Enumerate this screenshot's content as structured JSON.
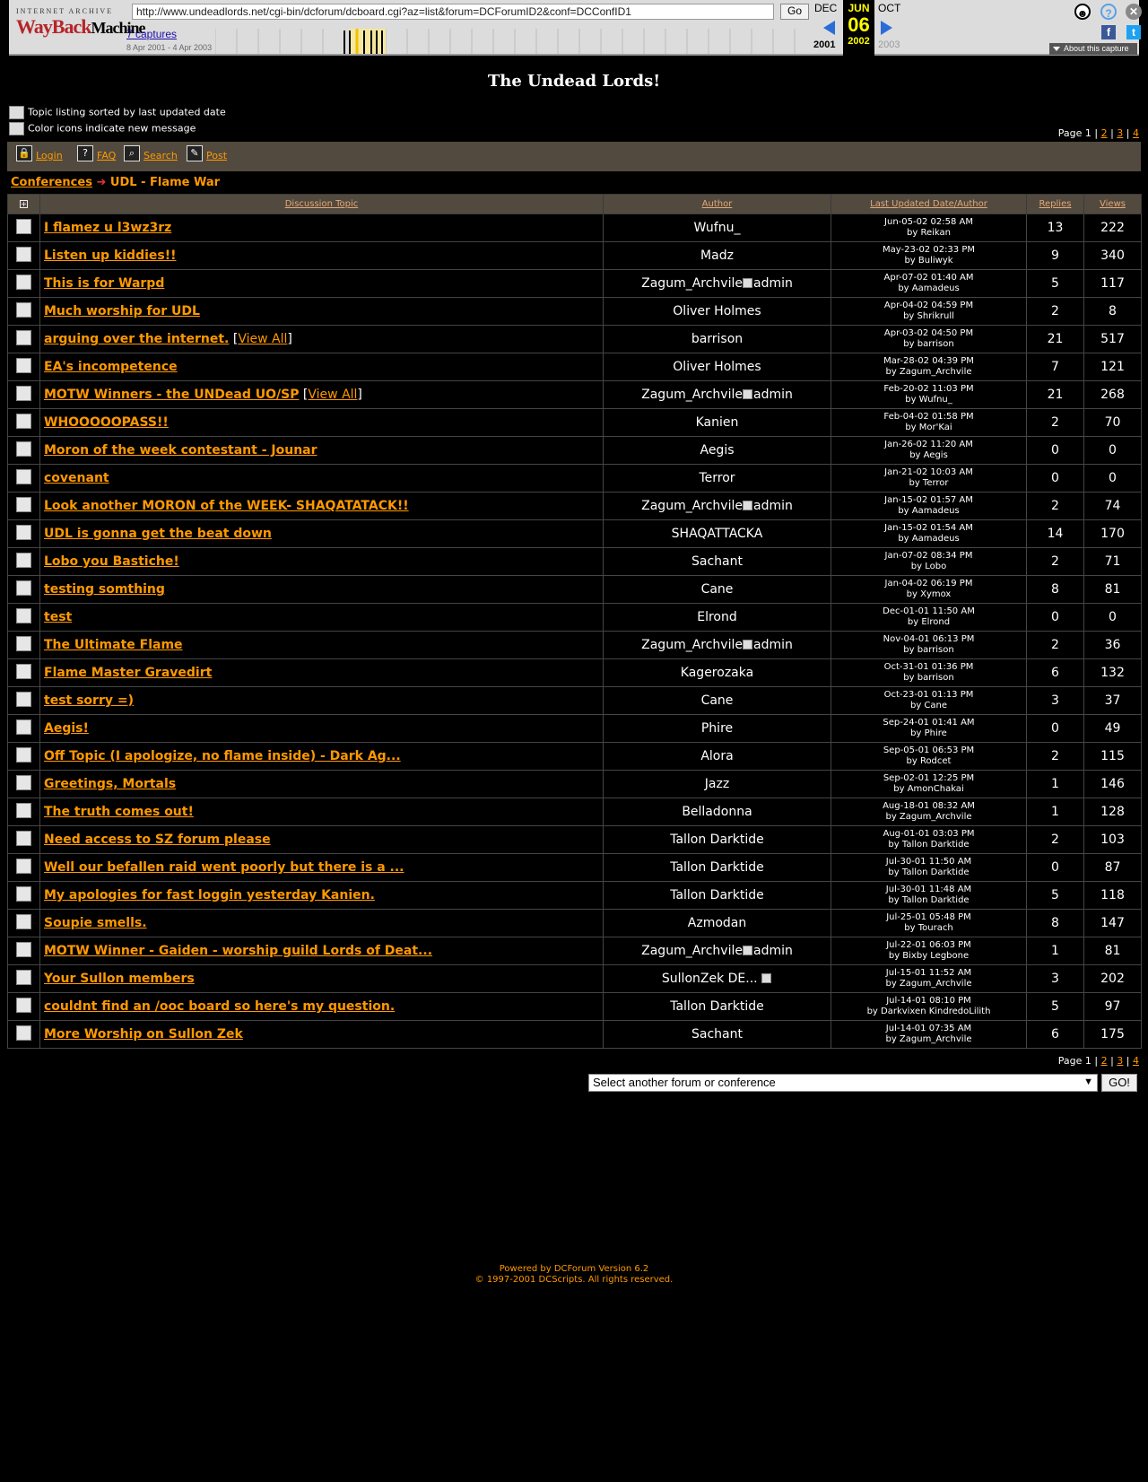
{
  "wayback": {
    "logo_top": "INTERNET ARCHIVE",
    "logo_main": "WayBack",
    "logo_sub": "Machine",
    "url": "http://www.undeadlords.net/cgi-bin/dcforum/dcboard.cgi?az=list&forum=DCForumID2&conf=DCConfID1",
    "go_label": "Go",
    "captures": "7 captures",
    "range": "8 Apr 2001 - 4 Apr 2003",
    "prev_month": "DEC",
    "cur_month": "JUN",
    "next_month": "OCT",
    "cur_day": "06",
    "prev_year": "2001",
    "cur_year": "2002",
    "next_year": "2003",
    "about": "About this capture"
  },
  "page": {
    "title": "The Undead Lords!",
    "legend1": "Topic listing sorted by last updated date",
    "legend2": "Color icons indicate new message",
    "page_label": "Page 1 | ",
    "pages": [
      "2",
      "3",
      "4"
    ],
    "toolbar": [
      "Login",
      "FAQ",
      "Search",
      "Post"
    ],
    "breadcrumb_root": "Conferences",
    "breadcrumb_forum": "UDL - Flame War",
    "select_placeholder": "Select another forum or conference",
    "select_go": "GO!",
    "footer1": "Powered by DCForum Version 6.2",
    "footer2": "© 1997-2001 DCScripts. All rights reserved."
  },
  "columns": [
    "Discussion Topic",
    "Author",
    "Last Updated Date/Author",
    "Replies",
    "Views"
  ],
  "topics": [
    {
      "title": "I flamez u l3wz3rz",
      "va": false,
      "author": "Wufnu_",
      "admin": false,
      "date": "Jun-05-02 02:58 AM",
      "by": "by Reikan",
      "replies": "13",
      "views": "222"
    },
    {
      "title": "Listen up kiddies!!",
      "va": false,
      "author": "Madz",
      "admin": false,
      "date": "May-23-02 02:33 PM",
      "by": "by Buliwyk",
      "replies": "9",
      "views": "340"
    },
    {
      "title": "This is for Warpd",
      "va": false,
      "author": "Zagum_Archvile",
      "admin": true,
      "date": "Apr-07-02 01:40 AM",
      "by": "by Aamadeus",
      "replies": "5",
      "views": "117"
    },
    {
      "title": "Much worship for UDL",
      "va": false,
      "author": "Oliver Holmes",
      "admin": false,
      "date": "Apr-04-02 04:59 PM",
      "by": "by Shrikrull",
      "replies": "2",
      "views": "8"
    },
    {
      "title": "arguing over the internet.",
      "va": true,
      "author": "barrison",
      "admin": false,
      "date": "Apr-03-02 04:50 PM",
      "by": "by barrison",
      "replies": "21",
      "views": "517"
    },
    {
      "title": "EA's incompetence",
      "va": false,
      "author": "Oliver Holmes",
      "admin": false,
      "date": "Mar-28-02 04:39 PM",
      "by": "by Zagum_Archvile",
      "replies": "7",
      "views": "121"
    },
    {
      "title": "MOTW Winners - the UNDead UO/SP",
      "va": true,
      "author": "Zagum_Archvile",
      "admin": true,
      "date": "Feb-20-02 11:03 PM",
      "by": "by Wufnu_",
      "replies": "21",
      "views": "268"
    },
    {
      "title": "WHOOOOOPASS!!",
      "va": false,
      "author": "Kanien",
      "admin": false,
      "date": "Feb-04-02 01:58 PM",
      "by": "by Mor'Kai",
      "replies": "2",
      "views": "70"
    },
    {
      "title": "Moron of the week contestant - Jounar",
      "va": false,
      "author": "Aegis",
      "admin": false,
      "date": "Jan-26-02 11:20 AM",
      "by": "by Aegis",
      "replies": "0",
      "views": "0"
    },
    {
      "title": "covenant",
      "va": false,
      "author": "Terror",
      "admin": false,
      "date": "Jan-21-02 10:03 AM",
      "by": "by Terror",
      "replies": "0",
      "views": "0"
    },
    {
      "title": "Look another MORON of the WEEK- SHAQATATACK!!",
      "va": false,
      "author": "Zagum_Archvile",
      "admin": true,
      "date": "Jan-15-02 01:57 AM",
      "by": "by Aamadeus",
      "replies": "2",
      "views": "74"
    },
    {
      "title": "UDL is gonna get the beat down",
      "va": false,
      "author": "SHAQATTACKA",
      "admin": false,
      "date": "Jan-15-02 01:54 AM",
      "by": "by Aamadeus",
      "replies": "14",
      "views": "170"
    },
    {
      "title": "Lobo you Bastiche!",
      "va": false,
      "author": "Sachant",
      "admin": false,
      "date": "Jan-07-02 08:34 PM",
      "by": "by Lobo",
      "replies": "2",
      "views": "71"
    },
    {
      "title": "testing somthing",
      "va": false,
      "author": "Cane",
      "admin": false,
      "date": "Jan-04-02 06:19 PM",
      "by": "by Xymox",
      "replies": "8",
      "views": "81"
    },
    {
      "title": "test",
      "va": false,
      "author": "Elrond",
      "admin": false,
      "date": "Dec-01-01 11:50 AM",
      "by": "by Elrond",
      "replies": "0",
      "views": "0"
    },
    {
      "title": "The Ultimate Flame",
      "va": false,
      "author": "Zagum_Archvile",
      "admin": true,
      "date": "Nov-04-01 06:13 PM",
      "by": "by barrison",
      "replies": "2",
      "views": "36"
    },
    {
      "title": "Flame Master Gravedirt",
      "va": false,
      "author": "Kagerozaka",
      "admin": false,
      "date": "Oct-31-01 01:36 PM",
      "by": "by barrison",
      "replies": "6",
      "views": "132"
    },
    {
      "title": "test sorry =)",
      "va": false,
      "author": "Cane",
      "admin": false,
      "date": "Oct-23-01 01:13 PM",
      "by": "by Cane",
      "replies": "3",
      "views": "37"
    },
    {
      "title": "Aegis!",
      "va": false,
      "author": "Phire",
      "admin": false,
      "date": "Sep-24-01 01:41 AM",
      "by": "by Phire",
      "replies": "0",
      "views": "49"
    },
    {
      "title": "Off Topic (I apologize, no flame inside) - Dark Ag...",
      "va": false,
      "author": "Alora",
      "admin": false,
      "date": "Sep-05-01 06:53 PM",
      "by": "by Rodcet",
      "replies": "2",
      "views": "115"
    },
    {
      "title": "Greetings, Mortals",
      "va": false,
      "author": "Jazz",
      "admin": false,
      "date": "Sep-02-01 12:25 PM",
      "by": "by AmonChakai",
      "replies": "1",
      "views": "146"
    },
    {
      "title": "The truth comes out!",
      "va": false,
      "author": "Belladonna",
      "admin": false,
      "date": "Aug-18-01 08:32 AM",
      "by": "by Zagum_Archvile",
      "replies": "1",
      "views": "128"
    },
    {
      "title": "Need access to SZ forum please",
      "va": false,
      "author": "Tallon Darktide",
      "admin": false,
      "date": "Aug-01-01 03:03 PM",
      "by": "by Tallon Darktide",
      "replies": "2",
      "views": "103"
    },
    {
      "title": "Well our befallen raid went poorly but there is a ...",
      "va": false,
      "author": "Tallon Darktide",
      "admin": false,
      "date": "Jul-30-01 11:50 AM",
      "by": "by Tallon Darktide",
      "replies": "0",
      "views": "87"
    },
    {
      "title": "My apologies for fast loggin yesterday Kanien.",
      "va": false,
      "author": "Tallon Darktide",
      "admin": false,
      "date": "Jul-30-01 11:48 AM",
      "by": "by Tallon Darktide",
      "replies": "5",
      "views": "118"
    },
    {
      "title": "Soupie smells.",
      "va": false,
      "author": "Azmodan",
      "admin": false,
      "date": "Jul-25-01 05:48 PM",
      "by": "by Tourach",
      "replies": "8",
      "views": "147"
    },
    {
      "title": "MOTW Winner - Gaiden - worship guild Lords of Deat...",
      "va": false,
      "author": "Zagum_Archvile",
      "admin": true,
      "date": "Jul-22-01 06:03 PM",
      "by": "by Bixby Legbone",
      "replies": "1",
      "views": "81"
    },
    {
      "title": "Your Sullon members",
      "va": false,
      "author": "SullonZek DE...",
      "admin": false,
      "trail": true,
      "date": "Jul-15-01 11:52 AM",
      "by": "by Zagum_Archvile",
      "replies": "3",
      "views": "202"
    },
    {
      "title": "couldnt find an /ooc board so here's my question.",
      "va": false,
      "author": "Tallon Darktide",
      "admin": false,
      "date": "Jul-14-01 08:10 PM",
      "by": "by Darkvixen KindredoLilith",
      "replies": "5",
      "views": "97"
    },
    {
      "title": "More Worship on Sullon Zek",
      "va": false,
      "author": "Sachant",
      "admin": false,
      "date": "Jul-14-01 07:35 AM",
      "by": "by Zagum_Archvile",
      "replies": "6",
      "views": "175"
    }
  ],
  "labels": {
    "view_all": "View All",
    "admin": "admin"
  }
}
